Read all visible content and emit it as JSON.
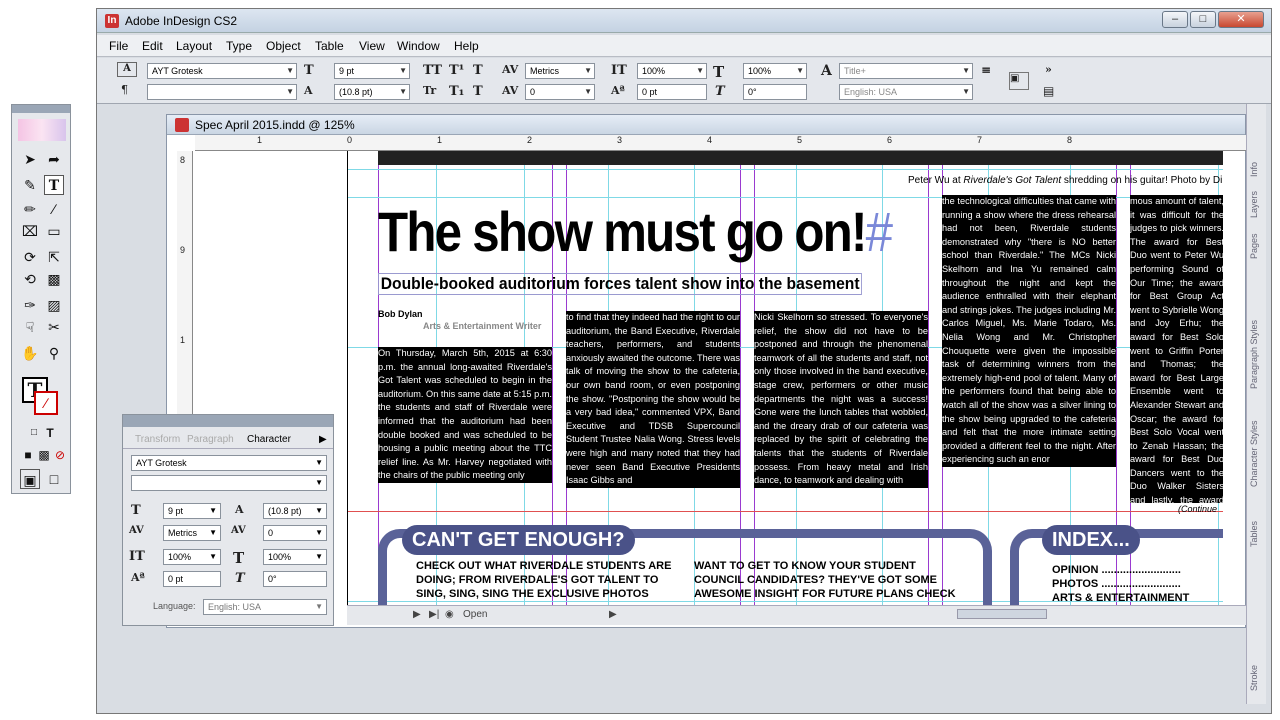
{
  "app": {
    "title": "Adobe InDesign CS2"
  },
  "menu": [
    "File",
    "Edit",
    "Layout",
    "Type",
    "Object",
    "Table",
    "View",
    "Window",
    "Help"
  ],
  "control": {
    "font": "AYT Grotesk",
    "style": "",
    "size": "9 pt",
    "leading": "(10.8 pt)",
    "kerning": "Metrics",
    "tracking": "0",
    "vscale": "100%",
    "baseline": "0 pt",
    "hscale": "100%",
    "skew": "0°",
    "char_style": "Title+",
    "language": "English: USA"
  },
  "document": {
    "title": "Spec April 2015.indd @ 125%",
    "ruler_h": [
      "1",
      "0",
      "1",
      "2",
      "3",
      "4",
      "5",
      "6",
      "7",
      "8"
    ],
    "ruler_v": [
      "8",
      "9",
      "1"
    ],
    "headline": "The show must go on!",
    "deck": "Double-booked auditorium forces talent show into the basement",
    "byline": "Bob Dylan",
    "section": "Arts & Entertainment Writer",
    "caption_prefix": "Peter Wu at ",
    "caption_italic": "Riverdale's Got Talent",
    "caption_suffix": " shredding on his guitar! Photo by Dil",
    "col1": "On Thursday, March 5th, 2015 at 6:30 p.m. the annual long-awaited Riverdale's Got Talent was scheduled to begin in the auditorium. On this same date at 5:15 p.m. the students and staff of Riverdale were informed that the auditorium had been double booked and was scheduled to be housing a public meeting about the TTC relief line. As Mr. Harvey negotiated with the chairs of the public meeting only",
    "col2": "to find that they indeed had the right to our auditorium, the Band Executive, Riverdale teachers, performers, and students anxiously awaited the outcome. There was talk of moving the show to the cafeteria, our own band room, or even postponing the show. \"Postponing the show would be a very bad idea,\" commented VPX, Band Executive and TDSB Supercouncil Student Trustee Nalia Wong. Stress levels were high and many noted that they had never seen Band Executive Presidents Isaac Gibbs and",
    "col3": "Nicki Skelhorn so stressed. To everyone's relief, the show did not have to be postponed and through the phenomenal teamwork of all the students and staff, not only those involved in the band executive, stage crew, performers or other music departments the night was a success! Gone were the lunch tables that wobbled, and the dreary drab of our cafeteria was replaced by the spirit of celebrating the talents that the students of Riverdale possess. From heavy metal and Irish dance, to teamwork and dealing with",
    "col4": "the technological difficulties that came with running a show where the dress rehearsal had not been, Riverdale students demonstrated why \"there is NO better school than Riverdale.\" The MCs Nicki Skelhorn and Ina Yu remained calm throughout the night and kept the audience enthralled with their elephant and strings jokes. The judges including Mr. Carlos Miguel, Ms. Marie Todaro, Ms. Nelia Wong and Mr. Christopher Chouquette were given the impossible task of determining winners from the extremely high-end pool of talent. Many of the performers found that being able to watch all of the show was a silver lining to the show being upgraded to the cafeteria and felt that the more intimate setting provided a different feel to the night. After experiencing such an enor",
    "col5": "mous amount of talent, it was difficult for the judges to pick winners. The award for Best Duo went to Peter Wu performing Sound of Our Time; the award for Best Group Act went to Sybrielle Wong and Joy Erhu; the award for Best Solo went to Griffin Porter and Thomas; the award for Best Large Ensemble went to Alexander Stewart and Oscar; the award for Best Solo Vocal went to Zenab Hassan; the award for Best Duo Dancers went to the Duo Walker Sisters and lastly, the award for Best Funk went to The Funk Revival. Of course the performers were extremely important to the night, but there were many people responsible for making the night run as smoothly as it did, Mrs. Halvey, Isaac Gibbs, Nicki S",
    "continued": "(Continue",
    "promo1_title": "CAN'T GET ENOUGH?",
    "promo1_text": "CHECK OUT WHAT RIVERDALE STUDENTS ARE DOING; FROM RIVERDALE'S GOT TALENT TO SING, SING, SING THE EXCLUSIVE PHOTOS",
    "promo2_text": "WANT TO GET TO KNOW YOUR STUDENT COUNCIL CANDIDATES? THEY'VE GOT SOME AWESOME INSIGHT FOR FUTURE PLANS CHECK",
    "index_title": "INDEX...",
    "index_items": [
      "OPINION ..........................",
      "PHOTOS ..........................",
      "ARTS & ENTERTAINMENT"
    ],
    "status": "Open"
  },
  "char_panel": {
    "tabs": [
      "Transform",
      "Paragraph",
      "Character"
    ],
    "font": "AYT Grotesk",
    "style": "",
    "size": "9 pt",
    "leading": "(10.8 pt)",
    "kerning": "Metrics",
    "tracking": "0",
    "vscale": "100%",
    "hscale": "100%",
    "baseline": "0 pt",
    "skew": "0°",
    "language_label": "Language:",
    "language": "English: USA"
  },
  "dock_tabs": [
    "Pages",
    "Layers",
    "Info",
    "Paragraph Styles",
    "Character Styles",
    "Tables",
    "Stroke"
  ],
  "colors": {
    "accent": "#5a6298",
    "guide_cyan": "#7fd9e6",
    "guide_purple": "#9a3ad0",
    "guide_red": "#e05050"
  }
}
